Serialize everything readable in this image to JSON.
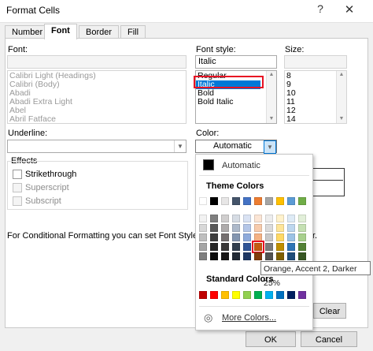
{
  "window": {
    "title": "Format Cells",
    "help": "?",
    "close": "✕"
  },
  "tabs": [
    "Number",
    "Font",
    "Border",
    "Fill"
  ],
  "font": {
    "label": "Font:",
    "value": "",
    "items": [
      "Calibri Light (Headings)",
      "Calibri (Body)",
      "Abadi",
      "Abadi Extra Light",
      "Abel",
      "Abril Fatface"
    ]
  },
  "font_style": {
    "label": "Font style:",
    "value": "Italic",
    "items": [
      "Regular",
      "Italic",
      "Bold",
      "Bold Italic"
    ],
    "selected": "Italic"
  },
  "size": {
    "label": "Size:",
    "value": "",
    "items": [
      "8",
      "9",
      "10",
      "11",
      "12",
      "14"
    ]
  },
  "underline": {
    "label": "Underline:",
    "value": ""
  },
  "color": {
    "label": "Color:",
    "value": "Automatic"
  },
  "effects": {
    "label": "Effects",
    "items": [
      {
        "label": "Strikethrough",
        "enabled": true
      },
      {
        "label": "Superscript",
        "enabled": false
      },
      {
        "label": "Subscript",
        "enabled": false
      }
    ]
  },
  "info_text": "For Conditional Formatting you can set Font Style, Un",
  "info_text_tail": "r.",
  "color_popup": {
    "automatic_label": "Automatic",
    "theme_colors_label": "Theme Colors",
    "standard_colors_label": "Standard Colors",
    "more_colors_label": "More Colors...",
    "theme_top": [
      "#ffffff",
      "#000000",
      "#e7e6e6",
      "#44546a",
      "#4472c4",
      "#ed7d31",
      "#a5a5a5",
      "#ffc000",
      "#5b9bd5",
      "#70ad47"
    ],
    "theme_shades": [
      [
        "#f2f2f2",
        "#7f7f7f",
        "#d0cece",
        "#d6dce4",
        "#d9e2f3",
        "#fbe5d5",
        "#ededed",
        "#fff2cc",
        "#deebf6",
        "#e2efd9"
      ],
      [
        "#d8d8d8",
        "#595959",
        "#aeabab",
        "#adb9ca",
        "#b4c6e7",
        "#f7cbac",
        "#dbdbdb",
        "#fee599",
        "#bdd7ee",
        "#c5e0b3"
      ],
      [
        "#bfbfbf",
        "#3f3f3f",
        "#757070",
        "#8496b0",
        "#8eaadb",
        "#f4b183",
        "#c9c9c9",
        "#ffd965",
        "#9cc3e5",
        "#a8d08d"
      ],
      [
        "#a5a5a5",
        "#262626",
        "#3a3838",
        "#323f4f",
        "#2f5496",
        "#c55a11",
        "#7b7b7b",
        "#bf8f00",
        "#2e75b5",
        "#538135"
      ],
      [
        "#7f7f7f",
        "#0c0c0c",
        "#171616",
        "#222a35",
        "#1f3864",
        "#833c0b",
        "#525252",
        "#7f6000",
        "#1e4e79",
        "#375623"
      ]
    ],
    "standard": [
      "#c00000",
      "#ff0000",
      "#ffc000",
      "#ffff00",
      "#92d050",
      "#00b050",
      "#00b0f0",
      "#0070c0",
      "#002060",
      "#7030a0"
    ],
    "tooltip": "Orange, Accent 2, Darker 25%"
  },
  "buttons": {
    "clear": "Clear",
    "ok": "OK",
    "cancel": "Cancel"
  },
  "accent": "#0078d7",
  "highlight": "#e81123"
}
